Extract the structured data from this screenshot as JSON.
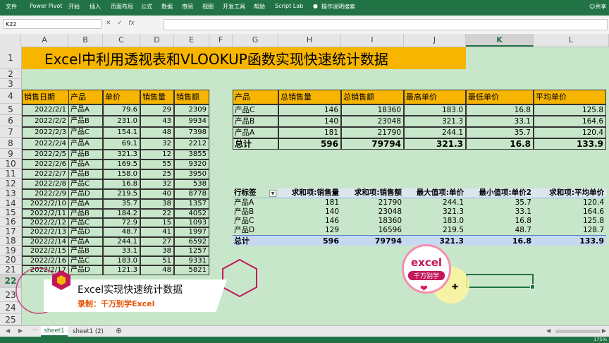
{
  "ribbon": {
    "tabs": [
      "文件",
      "Power Pivot",
      "开始",
      "插入",
      "页面布局",
      "公式",
      "数据",
      "审阅",
      "视图",
      "开发工具",
      "帮助",
      "Script Lab",
      "操作说明搜索"
    ],
    "share": "共享"
  },
  "formula_bar": {
    "name_box": "K22",
    "fx": "fx"
  },
  "columns": [
    "A",
    "B",
    "C",
    "D",
    "E",
    "F",
    "G",
    "H",
    "I",
    "J",
    "K",
    "L"
  ],
  "rows": [
    "1",
    "2",
    "3",
    "4",
    "5",
    "6",
    "7",
    "8",
    "9",
    "10",
    "11",
    "12",
    "13",
    "14",
    "15",
    "16",
    "17",
    "18",
    "19",
    "20",
    "21",
    "22",
    "23",
    "24",
    "25"
  ],
  "title": "Excel中利用透视表和VLOOKUP函数实现快速统计数据",
  "sales": {
    "headers": [
      "销售日期",
      "产品",
      "单价",
      "销售量",
      "销售额"
    ],
    "rows": [
      [
        "2022/2/1",
        "产品A",
        "79.6",
        "29",
        "2309"
      ],
      [
        "2022/2/2",
        "产品B",
        "231.0",
        "43",
        "9934"
      ],
      [
        "2022/2/3",
        "产品C",
        "154.1",
        "48",
        "7398"
      ],
      [
        "2022/2/4",
        "产品A",
        "69.1",
        "32",
        "2212"
      ],
      [
        "2022/2/5",
        "产品B",
        "321.3",
        "12",
        "3855"
      ],
      [
        "2022/2/6",
        "产品A",
        "169.5",
        "55",
        "9320"
      ],
      [
        "2022/2/7",
        "产品B",
        "158.0",
        "25",
        "3950"
      ],
      [
        "2022/2/8",
        "产品C",
        "16.8",
        "32",
        "538"
      ],
      [
        "2022/2/9",
        "产品D",
        "219.5",
        "40",
        "8778"
      ],
      [
        "2022/2/10",
        "产品A",
        "35.7",
        "38",
        "1357"
      ],
      [
        "2022/2/11",
        "产品B",
        "184.2",
        "22",
        "4052"
      ],
      [
        "2022/2/12",
        "产品C",
        "72.9",
        "15",
        "1093"
      ],
      [
        "2022/2/13",
        "产品D",
        "48.7",
        "41",
        "1997"
      ],
      [
        "2022/2/14",
        "产品A",
        "244.1",
        "27",
        "6592"
      ],
      [
        "2022/2/15",
        "产品B",
        "33.1",
        "38",
        "1257"
      ],
      [
        "2022/2/16",
        "产品C",
        "183.0",
        "51",
        "9331"
      ],
      [
        "2022/2/17",
        "产品D",
        "121.3",
        "48",
        "5821"
      ]
    ]
  },
  "summary": {
    "headers": [
      "产品",
      "总销售量",
      "总销售额",
      "最高单价",
      "最低单价",
      "平均单价"
    ],
    "rows": [
      [
        "产品C",
        "146",
        "18360",
        "183.0",
        "16.8",
        "125.8"
      ],
      [
        "产品B",
        "140",
        "23048",
        "321.3",
        "33.1",
        "164.6"
      ],
      [
        "产品A",
        "181",
        "21790",
        "244.1",
        "35.7",
        "120.4"
      ]
    ],
    "total": [
      "总计",
      "596",
      "79794",
      "321.3",
      "16.8",
      "133.9"
    ]
  },
  "pivot": {
    "headers": [
      "行标签",
      "求和项:销售量",
      "求和项:销售额",
      "最大值项:单价",
      "最小值项:单价2",
      "求和项:平均单价"
    ],
    "rows": [
      [
        "产品A",
        "181",
        "21790",
        "244.1",
        "35.7",
        "120.4"
      ],
      [
        "产品B",
        "140",
        "23048",
        "321.3",
        "33.1",
        "164.6"
      ],
      [
        "产品C",
        "146",
        "18360",
        "183.0",
        "16.8",
        "125.8"
      ],
      [
        "产品D",
        "129",
        "16596",
        "219.5",
        "48.7",
        "128.7"
      ]
    ],
    "total": [
      "总计",
      "596",
      "79794",
      "321.3",
      "16.8",
      "133.9"
    ]
  },
  "overlay": {
    "title": "Excel实现快速统计数据",
    "subtitle": "录制：千万别学Excel",
    "logo_top": "excel",
    "logo_bottom": "千万别学"
  },
  "sheets": [
    "sheet1",
    "sheet1 (2)"
  ],
  "status": {
    "zoom": "175%"
  },
  "colors": {
    "excel_green": "#217346",
    "header_orange": "#f7b500",
    "sheet_bg": "#c8e6c9",
    "pivot_band": "#c5d9f1",
    "accent_red": "#c2185b"
  }
}
